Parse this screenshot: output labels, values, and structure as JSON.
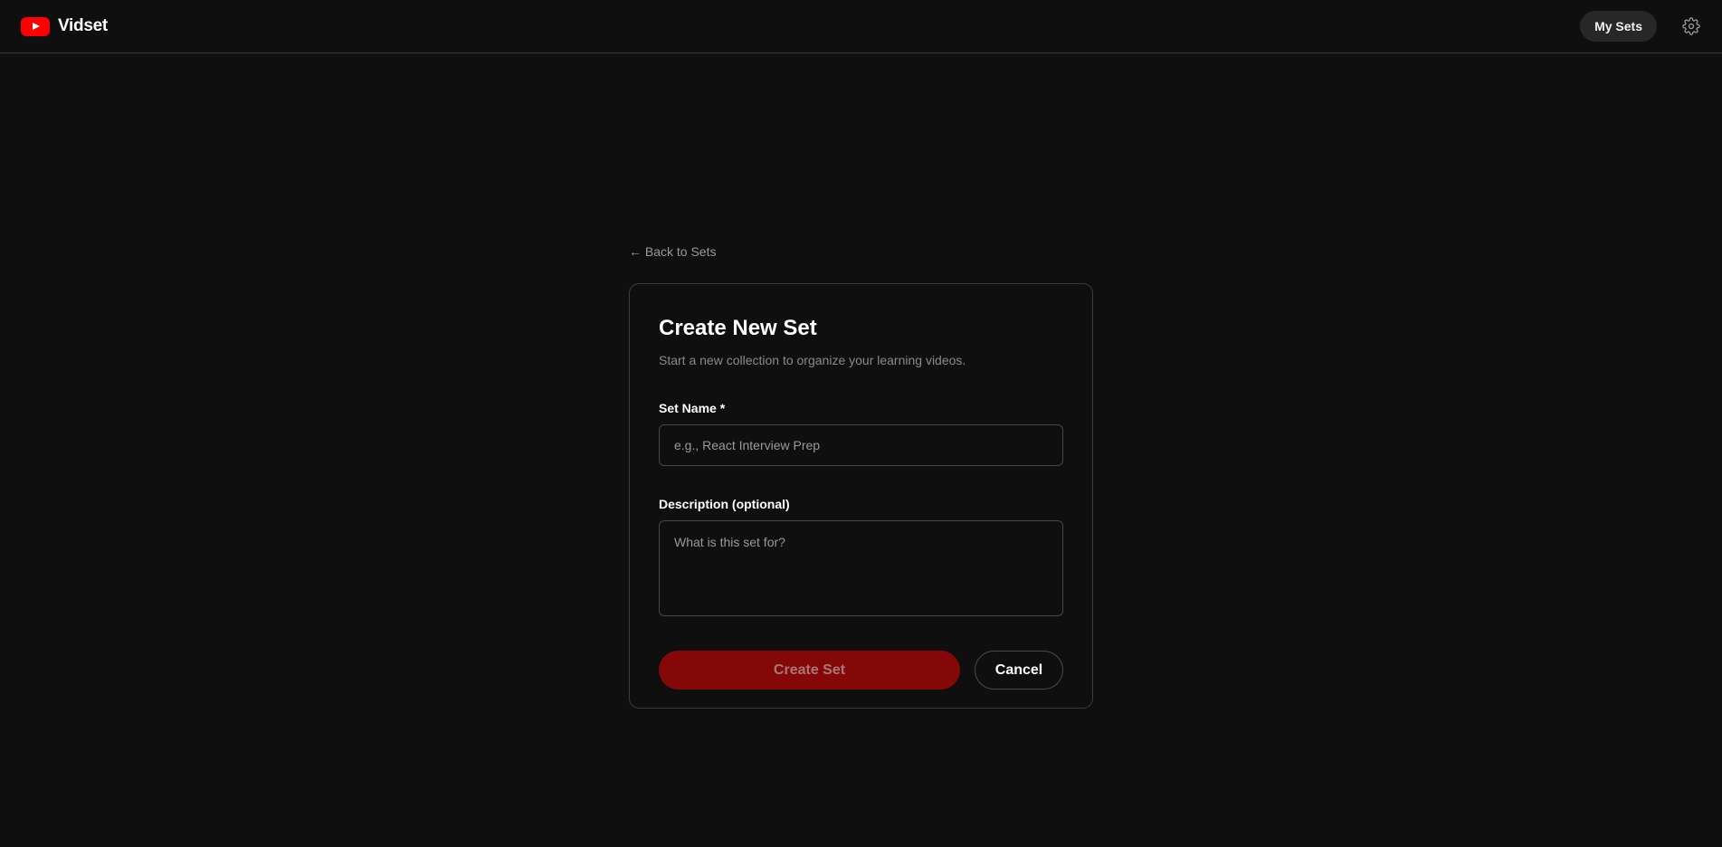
{
  "header": {
    "brand_name": "Vidset",
    "logo_icon": "play-logo-icon",
    "my_sets_label": "My Sets",
    "settings_icon": "gear-icon"
  },
  "page": {
    "back_link": "← Back to Sets"
  },
  "form": {
    "title": "Create New Set",
    "subtitle": "Start a new collection to organize your learning videos.",
    "set_name_label": "Set Name *",
    "set_name_placeholder": "e.g., React Interview Prep",
    "set_name_value": "",
    "description_label": "Description (optional)",
    "description_placeholder": "What is this set for?",
    "description_value": "",
    "create_label": "Create Set",
    "cancel_label": "Cancel"
  },
  "colors": {
    "background": "#0f0f0f",
    "brand_red": "#ff0000",
    "create_button_bg": "#850808",
    "border": "#3d3d3d"
  }
}
